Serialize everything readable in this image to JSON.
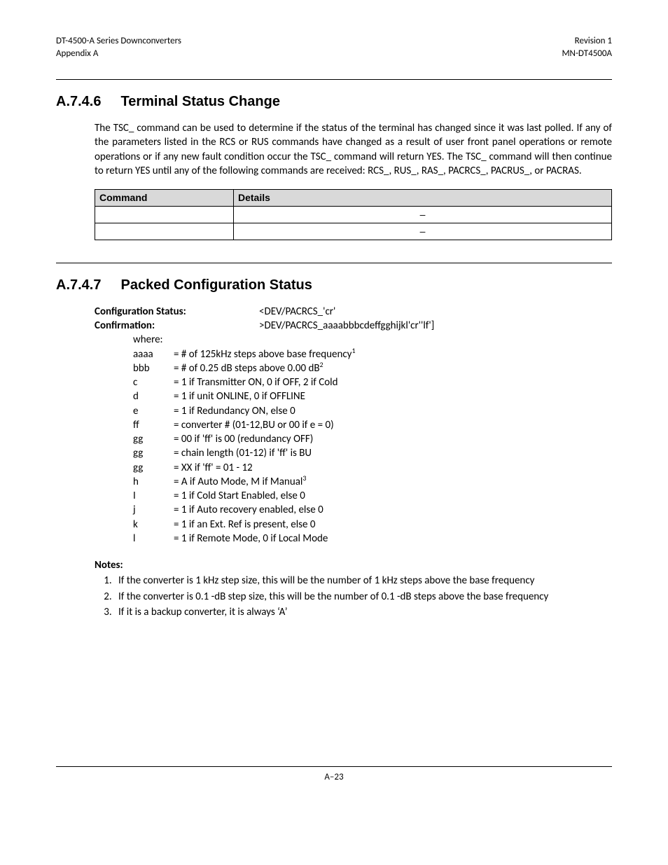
{
  "header": {
    "left1": "DT-4500-A Series Downconverters",
    "left2": "Appendix A",
    "right1": "Revision 1",
    "right2": "MN-DT4500A"
  },
  "section1": {
    "num": "A.7.4.6",
    "title": "Terminal Status Change",
    "para": "The TSC_ command can be used to determine if the status of the terminal has changed since it was last polled. If any of the parameters listed in the RCS or RUS commands have changed as a result of user front panel operations or remote operations or if any new fault condition occur the TSC_ command will return YES. The TSC_ command will then continue to return YES until any of the following commands are received: RCS_, RUS_, RAS_, PACRCS_, PACRUS_, or PACRAS.",
    "table": {
      "h1": "Command",
      "h2": "Details",
      "r1c1": "",
      "r1c2": "–",
      "r2c1": "",
      "r2c2": "–"
    }
  },
  "section2": {
    "num": "A.7.4.7",
    "title": "Packed Configuration Status",
    "cfg_status_label": "Configuration Status:",
    "cfg_status_value": "<DEV/PACRCS_'cr'",
    "confirmation_label": "Confirmation:",
    "confirmation_value": ">DEV/PACRCS_aaaabbbcdeffgghijkl'cr''lf']",
    "where": "where:",
    "params": [
      {
        "k": "aaaa",
        "v": "= # of 125kHz steps above base frequency",
        "sup": "1"
      },
      {
        "k": "bbb",
        "v": "= # of 0.25 dB steps above 0.00 dB",
        "sup": "2"
      },
      {
        "k": "c",
        "v": "= 1 if Transmitter ON, 0 if OFF, 2 if Cold"
      },
      {
        "k": "d",
        "v": "= 1 if unit ONLINE, 0 if OFFLINE"
      },
      {
        "k": "e",
        "v": "= 1 if Redundancy ON, else 0"
      },
      {
        "k": "ff",
        "v": "= converter # (01-12,BU or 00 if e = 0)"
      },
      {
        "k": "gg",
        "v": "= 00 if 'ff' is 00 (redundancy OFF)"
      },
      {
        "k": "gg",
        "v": "= chain length (01-12) if 'ff' is BU"
      },
      {
        "k": "gg",
        "v": "= XX if 'ff' = 01 - 12"
      },
      {
        "k": "h",
        "v": "= A if Auto Mode, M if Manual",
        "sup": "3"
      },
      {
        "k": "I",
        "v": "= 1 if Cold Start Enabled, else 0"
      },
      {
        "k": "j",
        "v": "= 1 if Auto recovery enabled, else 0"
      },
      {
        "k": "k",
        "v": "= 1 if an Ext. Ref is present, else 0"
      },
      {
        "k": "l",
        "v": "= 1 if Remote Mode, 0 if Local Mode"
      }
    ],
    "notes_title": "Notes:",
    "notes": [
      "If the  converter is 1 kHz step size, this will be the number of 1 kHz steps above the base frequency",
      "If the  converter is 0.1 -dB step size, this will be the number of 0.1 -dB steps above the base frequency",
      "If it is a backup converter, it is always ‘A’"
    ]
  },
  "footer": {
    "page": "A–23"
  }
}
